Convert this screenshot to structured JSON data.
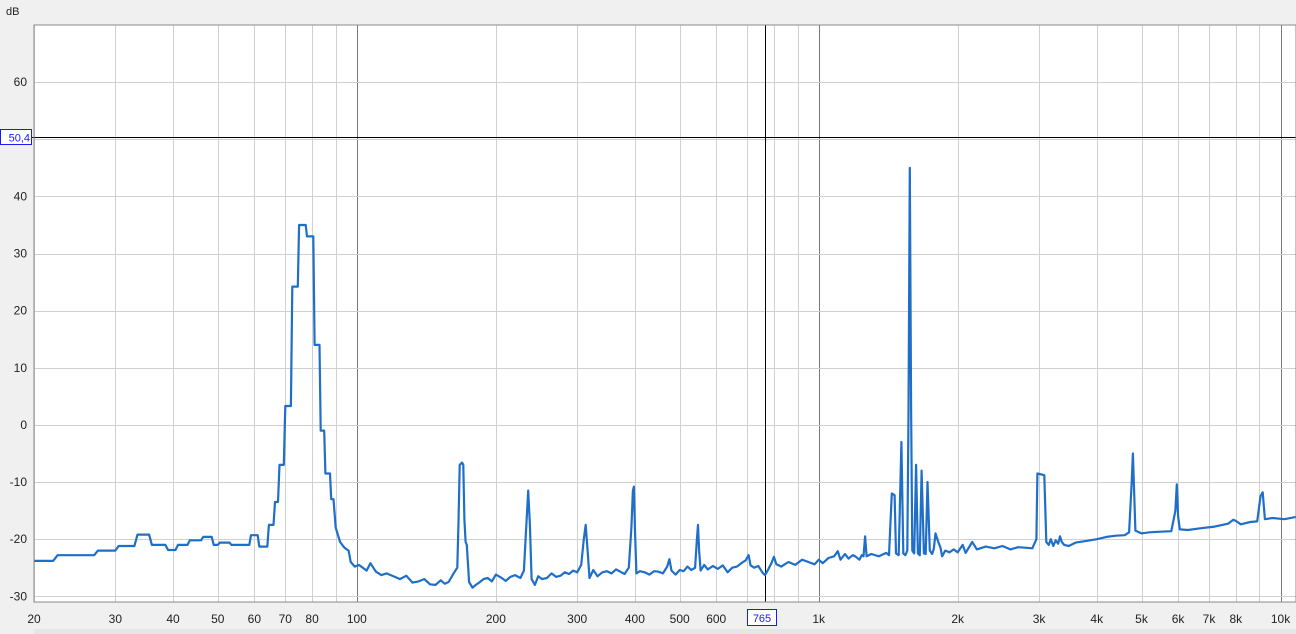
{
  "chart_data": {
    "type": "line",
    "title": "",
    "xlabel": "",
    "ylabel": "dB",
    "x_scale": "log",
    "xlim": [
      20,
      10800
    ],
    "ylim": [
      -31,
      70
    ],
    "grid": true,
    "x_ticks": [
      {
        "v": 20,
        "label": "20"
      },
      {
        "v": 30,
        "label": "30"
      },
      {
        "v": 40,
        "label": "40"
      },
      {
        "v": 50,
        "label": "50"
      },
      {
        "v": 60,
        "label": "60"
      },
      {
        "v": 70,
        "label": "70"
      },
      {
        "v": 80,
        "label": "80"
      },
      {
        "v": 100,
        "label": "100"
      },
      {
        "v": 200,
        "label": "200"
      },
      {
        "v": 300,
        "label": "300"
      },
      {
        "v": 400,
        "label": "400"
      },
      {
        "v": 500,
        "label": "500"
      },
      {
        "v": 600,
        "label": "600"
      },
      {
        "v": 1000,
        "label": "1k"
      },
      {
        "v": 2000,
        "label": "2k"
      },
      {
        "v": 3000,
        "label": "3k"
      },
      {
        "v": 4000,
        "label": "4k"
      },
      {
        "v": 5000,
        "label": "5k"
      },
      {
        "v": 6000,
        "label": "6k"
      },
      {
        "v": 7000,
        "label": "7k"
      },
      {
        "v": 8000,
        "label": "8k"
      },
      {
        "v": 10000,
        "label": "10k"
      }
    ],
    "x_grid_extra": [
      90,
      700,
      800,
      900,
      9000
    ],
    "y_ticks": [
      60,
      40,
      30,
      20,
      10,
      0,
      -10,
      -20,
      -30
    ],
    "y_grid_extra": [
      50
    ],
    "cursor": {
      "x": 765,
      "y": 50.4,
      "x_label": "765",
      "y_label": "50,4"
    },
    "line_color": "#1f6fc8",
    "series": [
      {
        "points": [
          [
            20,
            -23.8
          ],
          [
            22,
            -23.8
          ],
          [
            22.5,
            -22.8
          ],
          [
            27,
            -22.8
          ],
          [
            27.5,
            -22
          ],
          [
            30,
            -22
          ],
          [
            30.5,
            -21.2
          ],
          [
            33,
            -21.2
          ],
          [
            33.5,
            -19.2
          ],
          [
            35.5,
            -19.2
          ],
          [
            36,
            -21
          ],
          [
            38.5,
            -21
          ],
          [
            39,
            -21.9
          ],
          [
            40.5,
            -21.9
          ],
          [
            41,
            -21
          ],
          [
            43,
            -21
          ],
          [
            43.5,
            -20.2
          ],
          [
            46,
            -20.2
          ],
          [
            46.5,
            -19.6
          ],
          [
            48.5,
            -19.6
          ],
          [
            49,
            -21
          ],
          [
            50,
            -21
          ],
          [
            50.5,
            -20.6
          ],
          [
            53,
            -20.6
          ],
          [
            53.5,
            -21
          ],
          [
            58.5,
            -21
          ],
          [
            59,
            -19.3
          ],
          [
            61,
            -19.3
          ],
          [
            61.5,
            -21.3
          ],
          [
            64,
            -21.3
          ],
          [
            64.5,
            -17.5
          ],
          [
            66,
            -17.5
          ],
          [
            66.5,
            -13.5
          ],
          [
            67.5,
            -13.5
          ],
          [
            68,
            -7
          ],
          [
            69.5,
            -7
          ],
          [
            70,
            3.3
          ],
          [
            72,
            3.3
          ],
          [
            72.5,
            24.2
          ],
          [
            74.5,
            24.2
          ],
          [
            75,
            35
          ],
          [
            77.5,
            35
          ],
          [
            78,
            33
          ],
          [
            80.5,
            33
          ],
          [
            81,
            14
          ],
          [
            83,
            14
          ],
          [
            83.5,
            -1
          ],
          [
            85,
            -1
          ],
          [
            85.5,
            -8.5
          ],
          [
            87.5,
            -8.5
          ],
          [
            88,
            -13
          ],
          [
            89,
            -13
          ],
          [
            90,
            -18
          ],
          [
            92,
            -20.5
          ],
          [
            94,
            -21.5
          ],
          [
            96,
            -22
          ],
          [
            97,
            -24
          ],
          [
            99,
            -24.8
          ],
          [
            101,
            -24.5
          ],
          [
            103,
            -25
          ],
          [
            105,
            -25.5
          ],
          [
            107,
            -24.2
          ],
          [
            110,
            -25.7
          ],
          [
            113,
            -26.3
          ],
          [
            116,
            -26
          ],
          [
            120,
            -26.5
          ],
          [
            124,
            -27
          ],
          [
            128,
            -26.4
          ],
          [
            132,
            -27.6
          ],
          [
            136,
            -27.4
          ],
          [
            140,
            -27
          ],
          [
            144,
            -27.9
          ],
          [
            148,
            -28
          ],
          [
            152,
            -27.2
          ],
          [
            155,
            -27.8
          ],
          [
            158,
            -27.5
          ],
          [
            162,
            -26
          ],
          [
            165,
            -25
          ],
          [
            166,
            -17
          ],
          [
            167,
            -7
          ],
          [
            169,
            -6.6
          ],
          [
            170,
            -7
          ],
          [
            171,
            -16.5
          ],
          [
            172,
            -20.5
          ],
          [
            173,
            -21
          ],
          [
            175,
            -27.5
          ],
          [
            178,
            -28.5
          ],
          [
            181,
            -28
          ],
          [
            184,
            -27.6
          ],
          [
            188,
            -27
          ],
          [
            192,
            -26.8
          ],
          [
            196,
            -27.4
          ],
          [
            200,
            -26.2
          ],
          [
            205,
            -26.7
          ],
          [
            210,
            -27.3
          ],
          [
            215,
            -26.6
          ],
          [
            220,
            -26.3
          ],
          [
            226,
            -26.8
          ],
          [
            230,
            -25.5
          ],
          [
            233,
            -17
          ],
          [
            235,
            -11.5
          ],
          [
            237,
            -17.5
          ],
          [
            239,
            -27
          ],
          [
            243,
            -28
          ],
          [
            247,
            -26.5
          ],
          [
            252,
            -27
          ],
          [
            258,
            -26.8
          ],
          [
            264,
            -26
          ],
          [
            270,
            -26.6
          ],
          [
            276,
            -26.4
          ],
          [
            282,
            -25.8
          ],
          [
            288,
            -26.1
          ],
          [
            294,
            -25.5
          ],
          [
            300,
            -25.8
          ],
          [
            306,
            -24.5
          ],
          [
            310,
            -20
          ],
          [
            313,
            -17.5
          ],
          [
            316,
            -22
          ],
          [
            319,
            -26.8
          ],
          [
            325,
            -25.4
          ],
          [
            332,
            -26.5
          ],
          [
            340,
            -25.8
          ],
          [
            348,
            -25.6
          ],
          [
            356,
            -26
          ],
          [
            364,
            -25.3
          ],
          [
            372,
            -25.7
          ],
          [
            380,
            -26.1
          ],
          [
            388,
            -25
          ],
          [
            393,
            -18
          ],
          [
            396,
            -11.5
          ],
          [
            398,
            -10.8
          ],
          [
            400,
            -18
          ],
          [
            403,
            -26
          ],
          [
            410,
            -25.6
          ],
          [
            420,
            -25.8
          ],
          [
            430,
            -26.2
          ],
          [
            440,
            -25.6
          ],
          [
            450,
            -25.7
          ],
          [
            460,
            -26
          ],
          [
            470,
            -24.8
          ],
          [
            475,
            -23.5
          ],
          [
            480,
            -25.5
          ],
          [
            490,
            -26.2
          ],
          [
            500,
            -25.4
          ],
          [
            510,
            -25.6
          ],
          [
            520,
            -24.8
          ],
          [
            530,
            -25.4
          ],
          [
            540,
            -25
          ],
          [
            545,
            -20
          ],
          [
            548,
            -17.5
          ],
          [
            551,
            -22
          ],
          [
            555,
            -25.5
          ],
          [
            565,
            -24.5
          ],
          [
            575,
            -25.3
          ],
          [
            590,
            -24.7
          ],
          [
            605,
            -25.2
          ],
          [
            620,
            -24.6
          ],
          [
            635,
            -25.8
          ],
          [
            650,
            -25
          ],
          [
            665,
            -24.8
          ],
          [
            680,
            -24.2
          ],
          [
            695,
            -23.7
          ],
          [
            705,
            -22.8
          ],
          [
            712,
            -24.6
          ],
          [
            725,
            -25
          ],
          [
            740,
            -24.7
          ],
          [
            755,
            -25.8
          ],
          [
            765,
            -26.3
          ],
          [
            775,
            -25.5
          ],
          [
            790,
            -24.2
          ],
          [
            800,
            -23.1
          ],
          [
            810,
            -24.4
          ],
          [
            830,
            -24.8
          ],
          [
            860,
            -24
          ],
          [
            890,
            -24.5
          ],
          [
            920,
            -23.6
          ],
          [
            950,
            -24
          ],
          [
            980,
            -24.4
          ],
          [
            1000,
            -23.6
          ],
          [
            1020,
            -24.2
          ],
          [
            1050,
            -23.3
          ],
          [
            1080,
            -23
          ],
          [
            1100,
            -22.1
          ],
          [
            1115,
            -23.6
          ],
          [
            1140,
            -22.6
          ],
          [
            1160,
            -23.4
          ],
          [
            1185,
            -22.8
          ],
          [
            1200,
            -23
          ],
          [
            1225,
            -23.6
          ],
          [
            1240,
            -22.8
          ],
          [
            1250,
            -23
          ],
          [
            1260,
            -19.5
          ],
          [
            1270,
            -23
          ],
          [
            1300,
            -22.6
          ],
          [
            1350,
            -23
          ],
          [
            1400,
            -22.4
          ],
          [
            1420,
            -22.8
          ],
          [
            1440,
            -12
          ],
          [
            1460,
            -12.3
          ],
          [
            1470,
            -22.5
          ],
          [
            1490,
            -22.8
          ],
          [
            1510,
            -3
          ],
          [
            1525,
            -22.5
          ],
          [
            1540,
            -22.8
          ],
          [
            1555,
            -22
          ],
          [
            1565,
            2
          ],
          [
            1575,
            45
          ],
          [
            1585,
            3
          ],
          [
            1595,
            -22
          ],
          [
            1610,
            -22.5
          ],
          [
            1625,
            -7
          ],
          [
            1640,
            -22.5
          ],
          [
            1655,
            -22.8
          ],
          [
            1670,
            -8
          ],
          [
            1690,
            -22.5
          ],
          [
            1705,
            -22.6
          ],
          [
            1720,
            -10
          ],
          [
            1740,
            -22
          ],
          [
            1760,
            -22.6
          ],
          [
            1775,
            -21.7
          ],
          [
            1790,
            -19
          ],
          [
            1815,
            -20.5
          ],
          [
            1835,
            -21.5
          ],
          [
            1850,
            -23
          ],
          [
            1880,
            -22
          ],
          [
            1920,
            -22.3
          ],
          [
            1960,
            -21.8
          ],
          [
            2000,
            -22.3
          ],
          [
            2050,
            -21
          ],
          [
            2080,
            -22.4
          ],
          [
            2150,
            -20.5
          ],
          [
            2200,
            -21.8
          ],
          [
            2300,
            -21.3
          ],
          [
            2400,
            -21.6
          ],
          [
            2500,
            -21.2
          ],
          [
            2600,
            -21.8
          ],
          [
            2700,
            -21.4
          ],
          [
            2800,
            -21.5
          ],
          [
            2900,
            -21.6
          ],
          [
            2960,
            -20
          ],
          [
            2975,
            -8.5
          ],
          [
            3080,
            -8.8
          ],
          [
            3110,
            -20.5
          ],
          [
            3150,
            -21
          ],
          [
            3180,
            -20
          ],
          [
            3220,
            -21.2
          ],
          [
            3260,
            -20.2
          ],
          [
            3300,
            -20.8
          ],
          [
            3330,
            -19.5
          ],
          [
            3360,
            -20.5
          ],
          [
            3400,
            -21
          ],
          [
            3480,
            -21.2
          ],
          [
            3600,
            -20.6
          ],
          [
            3800,
            -20.3
          ],
          [
            4000,
            -20
          ],
          [
            4200,
            -19.6
          ],
          [
            4400,
            -19.4
          ],
          [
            4600,
            -19.3
          ],
          [
            4700,
            -18.8
          ],
          [
            4760,
            -10
          ],
          [
            4790,
            -5
          ],
          [
            4820,
            -12
          ],
          [
            4850,
            -18.5
          ],
          [
            5000,
            -19
          ],
          [
            5200,
            -18.8
          ],
          [
            5500,
            -18.7
          ],
          [
            5800,
            -18.6
          ],
          [
            5920,
            -15
          ],
          [
            5960,
            -10.4
          ],
          [
            6000,
            -16
          ],
          [
            6050,
            -18.3
          ],
          [
            6300,
            -18.4
          ],
          [
            6700,
            -18.1
          ],
          [
            7200,
            -17.8
          ],
          [
            7700,
            -17.3
          ],
          [
            7900,
            -16.6
          ],
          [
            8000,
            -16.8
          ],
          [
            8200,
            -17.4
          ],
          [
            8600,
            -17
          ],
          [
            8900,
            -16.9
          ],
          [
            9050,
            -12.5
          ],
          [
            9150,
            -11.8
          ],
          [
            9250,
            -16.5
          ],
          [
            9600,
            -16.3
          ],
          [
            10200,
            -16.5
          ],
          [
            10800,
            -16.1
          ]
        ]
      }
    ]
  }
}
